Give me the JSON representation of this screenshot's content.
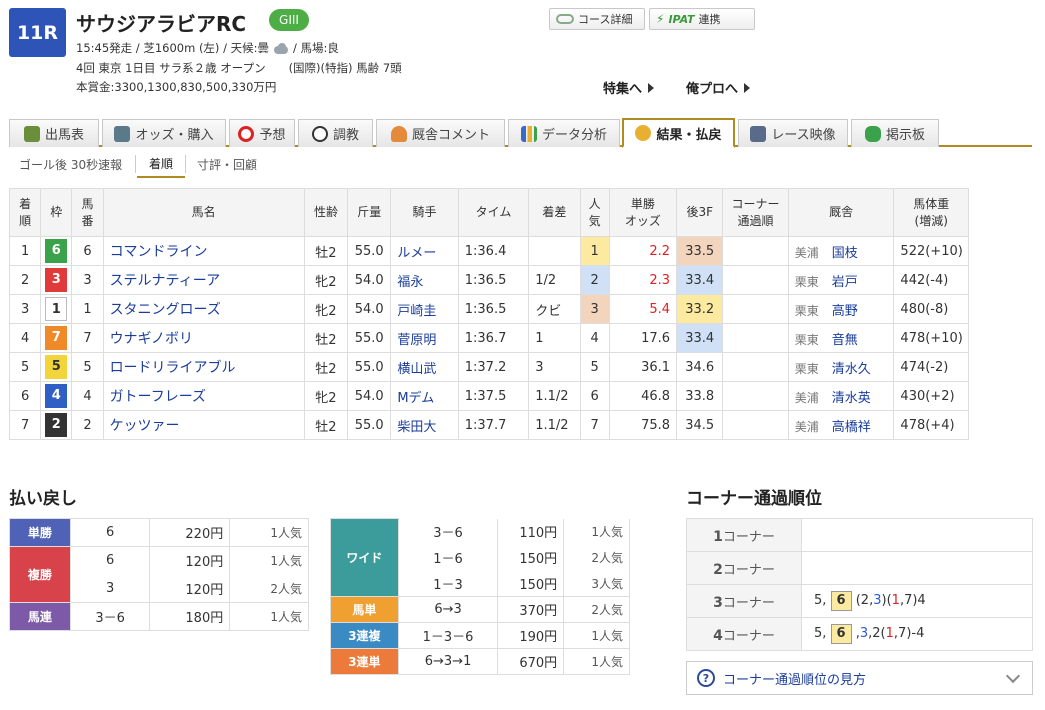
{
  "race": {
    "number": "11R",
    "name": "サウジアラビアRC",
    "grade": "GIII",
    "info1": "15:45発走 / 芝1600m (左) / 天候:曇",
    "info1b": "/ 馬場:良",
    "info2": "4回 東京 1日目 サラ系２歳 オープン　　(国際)(特指) 馬齢 7頭",
    "info3": "本賞金:3300,1300,830,500,330万円"
  },
  "buttons": {
    "course": "コース詳細",
    "ipat": "IPAT",
    "ipat_suffix": "連携"
  },
  "links": {
    "tokushu": "特集へ",
    "orepro": "俺プロへ"
  },
  "tabs": [
    "出馬表",
    "オッズ・購入",
    "予想",
    "調教",
    "厩舎コメント",
    "データ分析",
    "結果・払戻",
    "レース映像",
    "掲示板"
  ],
  "subtabs": [
    "ゴール後 30秒速報",
    "着順",
    "寸評・回顧"
  ],
  "results_header": [
    "着順",
    "枠",
    "馬番",
    "馬名",
    "性齢",
    "斤量",
    "騎手",
    "タイム",
    "着差",
    "人気",
    "単勝オッズ",
    "後3F",
    "コーナー通過順",
    "厩舎",
    "馬体重(増減)"
  ],
  "header_split": {
    "rank": [
      "着",
      "順"
    ],
    "waku": [
      "枠"
    ],
    "umaban": [
      "馬",
      "番"
    ],
    "pop": [
      "人",
      "気"
    ],
    "odds": [
      "単勝",
      "オッズ"
    ],
    "corner": [
      "コーナー",
      "通過順"
    ],
    "weight": [
      "馬体重",
      "(増減)"
    ]
  },
  "results": [
    {
      "rank": "1",
      "waku": "6",
      "umaban": "6",
      "horse": "コマンドライン",
      "sexage": "牡2",
      "kinryo": "55.0",
      "jockey": "ルメー",
      "time": "1:36.4",
      "margin": "",
      "pop": "1",
      "odds": "2.2",
      "f3": "33.5",
      "corner": "",
      "loc": "美浦",
      "trainer": "国枝",
      "weight": "522(+10)"
    },
    {
      "rank": "2",
      "waku": "3",
      "umaban": "3",
      "horse": "ステルナティーア",
      "sexage": "牝2",
      "kinryo": "54.0",
      "jockey": "福永",
      "time": "1:36.5",
      "margin": "1/2",
      "pop": "2",
      "odds": "2.3",
      "f3": "33.4",
      "corner": "",
      "loc": "栗東",
      "trainer": "岩戸",
      "weight": "442(-4)"
    },
    {
      "rank": "3",
      "waku": "1",
      "umaban": "1",
      "horse": "スタニングローズ",
      "sexage": "牝2",
      "kinryo": "54.0",
      "jockey": "戸崎圭",
      "time": "1:36.5",
      "margin": "クビ",
      "pop": "3",
      "odds": "5.4",
      "f3": "33.2",
      "corner": "",
      "loc": "栗東",
      "trainer": "高野",
      "weight": "480(-8)"
    },
    {
      "rank": "4",
      "waku": "7",
      "umaban": "7",
      "horse": "ウナギノボリ",
      "sexage": "牡2",
      "kinryo": "55.0",
      "jockey": "菅原明",
      "time": "1:36.7",
      "margin": "1",
      "pop": "4",
      "odds": "17.6",
      "f3": "33.4",
      "corner": "",
      "loc": "栗東",
      "trainer": "音無",
      "weight": "478(+10)"
    },
    {
      "rank": "5",
      "waku": "5",
      "umaban": "5",
      "horse": "ロードリライアブル",
      "sexage": "牡2",
      "kinryo": "55.0",
      "jockey": "横山武",
      "time": "1:37.2",
      "margin": "3",
      "pop": "5",
      "odds": "36.1",
      "f3": "34.6",
      "corner": "",
      "loc": "栗東",
      "trainer": "清水久",
      "weight": "474(-2)"
    },
    {
      "rank": "6",
      "waku": "4",
      "umaban": "4",
      "horse": "ガトーフレーズ",
      "sexage": "牝2",
      "kinryo": "54.0",
      "jockey": "Mデム",
      "time": "1:37.5",
      "margin": "1.1/2",
      "pop": "6",
      "odds": "46.8",
      "f3": "33.8",
      "corner": "",
      "loc": "美浦",
      "trainer": "清水英",
      "weight": "430(+2)"
    },
    {
      "rank": "7",
      "waku": "2",
      "umaban": "2",
      "horse": "ケッツァー",
      "sexage": "牡2",
      "kinryo": "55.0",
      "jockey": "柴田大",
      "time": "1:37.7",
      "margin": "1.1/2",
      "pop": "7",
      "odds": "75.8",
      "f3": "34.5",
      "corner": "",
      "loc": "美浦",
      "trainer": "高橋祥",
      "weight": "478(+4)"
    }
  ],
  "waku_colors": {
    "1": "#ffffff",
    "2": "#333333",
    "3": "#e03a3a",
    "4": "#2f5ec4",
    "5": "#f1d53a",
    "6": "#3aa24a",
    "7": "#f08a28"
  },
  "payout_title": "払い戻し",
  "payout_left": [
    {
      "label": "単勝",
      "color": "#4f62b5",
      "rows": [
        {
          "combo": "6",
          "amount": "220円",
          "pop": "1人気"
        }
      ]
    },
    {
      "label": "複勝",
      "color": "#d8424a",
      "rows": [
        {
          "combo": "6",
          "amount": "120円",
          "pop": "1人気"
        },
        {
          "combo": "3",
          "amount": "120円",
          "pop": "2人気"
        }
      ]
    },
    {
      "label": "馬連",
      "color": "#7d5aa8",
      "rows": [
        {
          "combo": "3－6",
          "amount": "180円",
          "pop": "1人気"
        }
      ]
    }
  ],
  "payout_right": [
    {
      "label": "ワイド",
      "color": "#3c9c9c",
      "rows": [
        {
          "combo": "3－6",
          "amount": "110円",
          "pop": "1人気"
        },
        {
          "combo": "1－6",
          "amount": "150円",
          "pop": "2人気"
        },
        {
          "combo": "1－3",
          "amount": "150円",
          "pop": "3人気"
        }
      ]
    },
    {
      "label": "馬単",
      "color": "#f0a030",
      "rows": [
        {
          "combo": "6→3",
          "amount": "370円",
          "pop": "2人気"
        }
      ]
    },
    {
      "label": "3連複",
      "color": "#3a8ac4",
      "rows": [
        {
          "combo": "1－3－6",
          "amount": "190円",
          "pop": "1人気"
        }
      ]
    },
    {
      "label": "3連単",
      "color": "#ec7a3a",
      "rows": [
        {
          "combo": "6→3→1",
          "amount": "670円",
          "pop": "1人気"
        }
      ]
    }
  ],
  "corner_title": "コーナー通過順位",
  "corners": [
    {
      "num": "1",
      "label": "コーナー"
    },
    {
      "num": "2",
      "label": "コーナー"
    },
    {
      "num": "3",
      "label": "コーナー"
    },
    {
      "num": "4",
      "label": "コーナー"
    }
  ],
  "corner_orders": {
    "c3": {
      "before": "5,",
      "box": "6",
      "mid": [
        "(2,",
        "3",
        ")(",
        "1",
        ",7)4"
      ]
    },
    "c4": {
      "before": "5,",
      "box": "6",
      "mid": [
        ",",
        "3",
        ",2(",
        "1",
        ",7)-4"
      ]
    }
  },
  "howto": "コーナー通過順位の見方"
}
